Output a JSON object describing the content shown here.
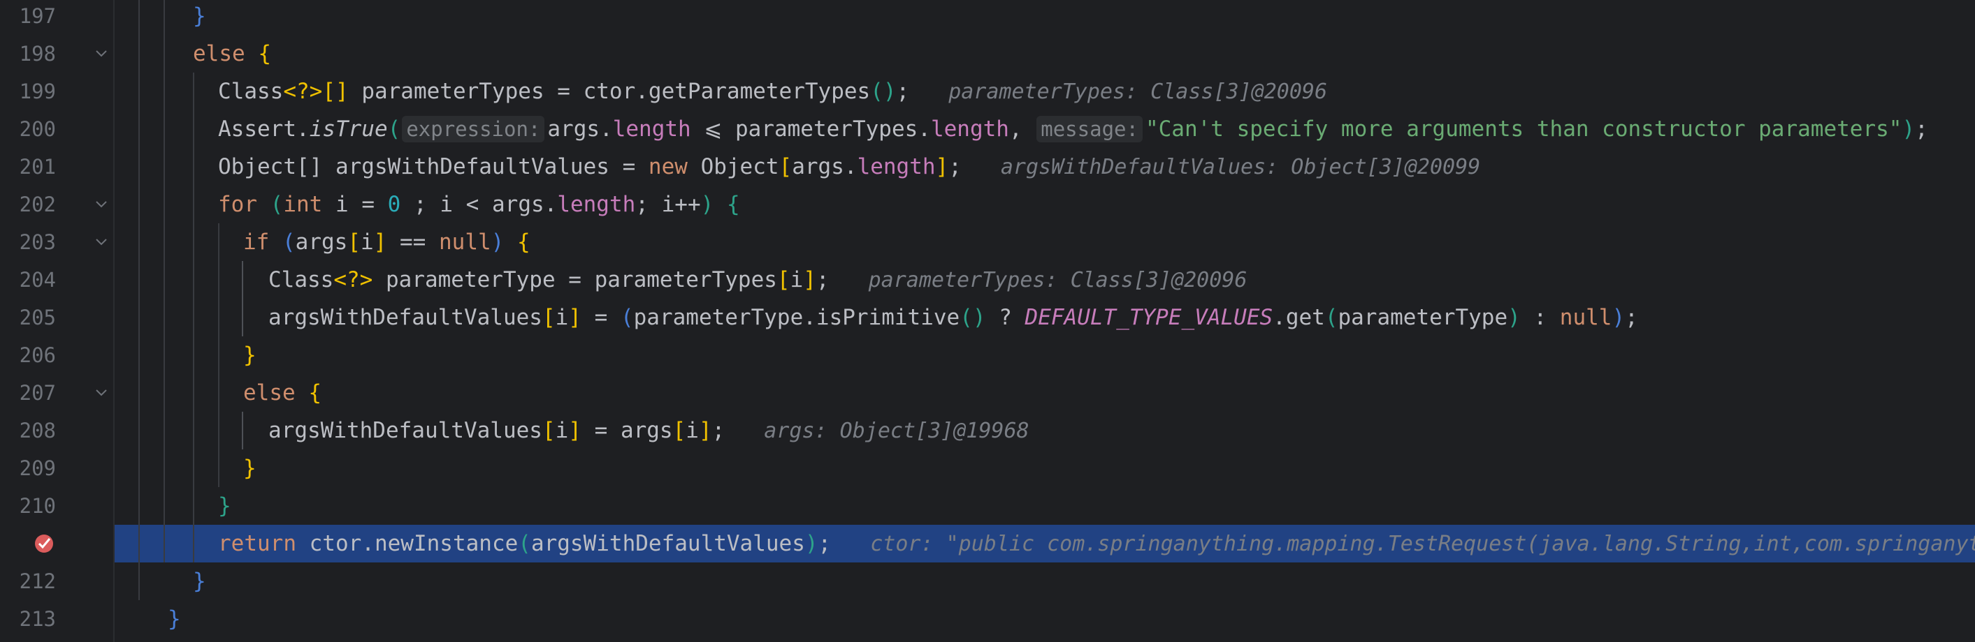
{
  "editor": {
    "lines": [
      {
        "num": "197"
      },
      {
        "num": "198"
      },
      {
        "num": "199"
      },
      {
        "num": "200"
      },
      {
        "num": "201"
      },
      {
        "num": "202"
      },
      {
        "num": "203"
      },
      {
        "num": "204"
      },
      {
        "num": "205"
      },
      {
        "num": "206"
      },
      {
        "num": "207"
      },
      {
        "num": "208"
      },
      {
        "num": "209"
      },
      {
        "num": "210"
      },
      {
        "num": ""
      },
      {
        "num": "212"
      },
      {
        "num": "213"
      }
    ],
    "tokens": {
      "kw_else": "else",
      "kw_for": "for",
      "kw_int": "int",
      "kw_if": "if",
      "kw_null": "null",
      "kw_new": "new",
      "kw_return": "return",
      "l199_type": "Class",
      "l199_generic": "<?>",
      "l199_arr": "[]",
      "l199_rest": " parameterTypes = ctor.getParameterTypes",
      "l200_assert": "Assert.",
      "l200_istrue": "isTrue",
      "l200_hint1": "expression:",
      "l200_args": "args.",
      "l200_length": "length",
      "l200_le": " ⩽ parameterTypes.",
      "l200_length2": "length",
      "l200_hint2": "message:",
      "l200_str": "\"Can't specify more arguments than constructor parameters\"",
      "l201_a": "Object[] argsWithDefaultValues = ",
      "l201_b": " Object",
      "l201_c": "args.",
      "l201_len": "length",
      "l202_a": " i = ",
      "l202_zero": "0",
      "l202_b": " ; i < args.",
      "l202_len": "length",
      "l202_c": "; i++",
      "l203_a": "args",
      "l203_b": "i",
      "l203_c": " == ",
      "l204_type": "Class",
      "l204_generic": "<?>",
      "l204_rest": " parameterType = parameterTypes",
      "l204_i": "i",
      "l205_a": "argsWithDefaultValues",
      "l205_i": "i",
      "l205_b": " = ",
      "l205_c": "parameterType.isPrimitive",
      "l205_d": " ? ",
      "l205_const": "DEFAULT_TYPE_VALUES",
      "l205_e": ".get",
      "l205_f": "parameterType",
      "l205_g": " : ",
      "l208_a": "argsWithDefaultValues",
      "l208_i": "i",
      "l208_b": " = args",
      "l208_i2": "i",
      "l211_a": " ctor.newInstance",
      "l211_b": "argsWithDefaultValues"
    },
    "inline_values": {
      "l199": "parameterTypes: Class[3]@20096",
      "l201": "argsWithDefaultValues: Object[3]@20099",
      "l204": "parameterTypes: Class[3]@20096",
      "l208": "args: Object[3]@19968",
      "l211": "ctor: \"public com.springanything.mapping.TestRequest(java.lang.String,int,com.springanythi"
    }
  }
}
